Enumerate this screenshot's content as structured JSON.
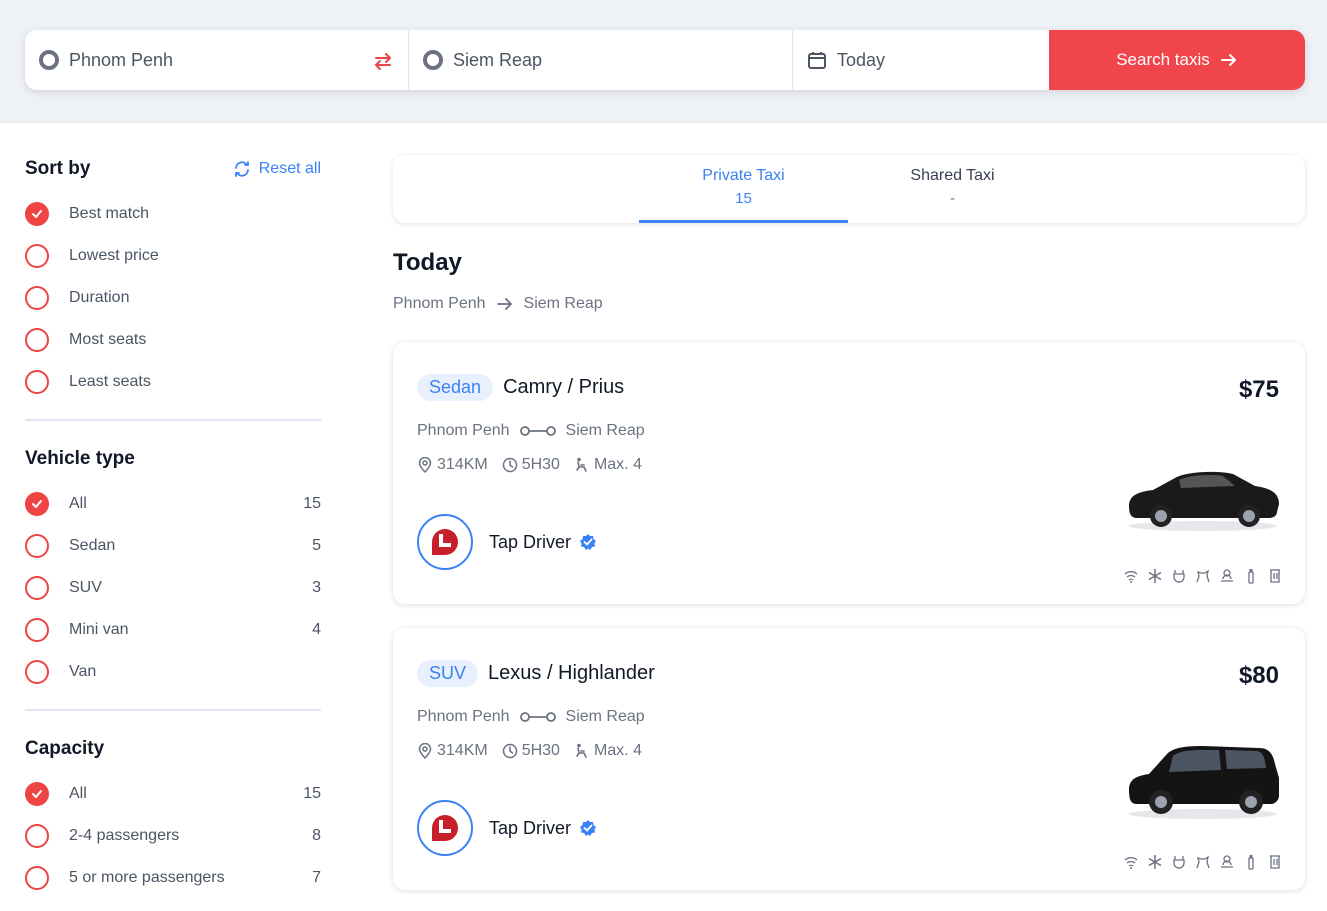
{
  "search": {
    "from": "Phnom Penh",
    "to": "Siem Reap",
    "date": "Today",
    "button": "Search taxis"
  },
  "sidebar": {
    "sort": {
      "title": "Sort by",
      "reset": "Reset all",
      "options": [
        {
          "label": "Best match",
          "checked": true
        },
        {
          "label": "Lowest price",
          "checked": false
        },
        {
          "label": "Duration",
          "checked": false
        },
        {
          "label": "Most seats",
          "checked": false
        },
        {
          "label": "Least seats",
          "checked": false
        }
      ]
    },
    "vehicle": {
      "title": "Vehicle type",
      "options": [
        {
          "label": "All",
          "count": "15",
          "checked": true
        },
        {
          "label": "Sedan",
          "count": "5",
          "checked": false
        },
        {
          "label": "SUV",
          "count": "3",
          "checked": false
        },
        {
          "label": "Mini van",
          "count": "4",
          "checked": false
        },
        {
          "label": "Van",
          "count": "",
          "checked": false
        }
      ]
    },
    "capacity": {
      "title": "Capacity",
      "options": [
        {
          "label": "All",
          "count": "15",
          "checked": true
        },
        {
          "label": "2-4 passengers",
          "count": "8",
          "checked": false
        },
        {
          "label": "5 or more passengers",
          "count": "7",
          "checked": false
        }
      ]
    }
  },
  "tabs": [
    {
      "label": "Private Taxi",
      "sub": "15",
      "active": true
    },
    {
      "label": "Shared Taxi",
      "sub": "-",
      "active": false
    }
  ],
  "results": {
    "day": "Today",
    "from": "Phnom Penh",
    "to": "Siem Reap",
    "cards": [
      {
        "type": "Sedan",
        "name": "Camry / Prius",
        "price": "$75",
        "from": "Phnom Penh",
        "to": "Siem Reap",
        "distance": "314KM",
        "duration": "5H30",
        "seats": "Max. 4",
        "driver": "Tap Driver"
      },
      {
        "type": "SUV",
        "name": "Lexus / Highlander",
        "price": "$80",
        "from": "Phnom Penh",
        "to": "Siem Reap",
        "distance": "314KM",
        "duration": "5H30",
        "seats": "Max. 4",
        "driver": "Tap Driver"
      }
    ]
  },
  "colors": {
    "accent_red": "#f0454b",
    "accent_blue": "#3b82f6"
  }
}
